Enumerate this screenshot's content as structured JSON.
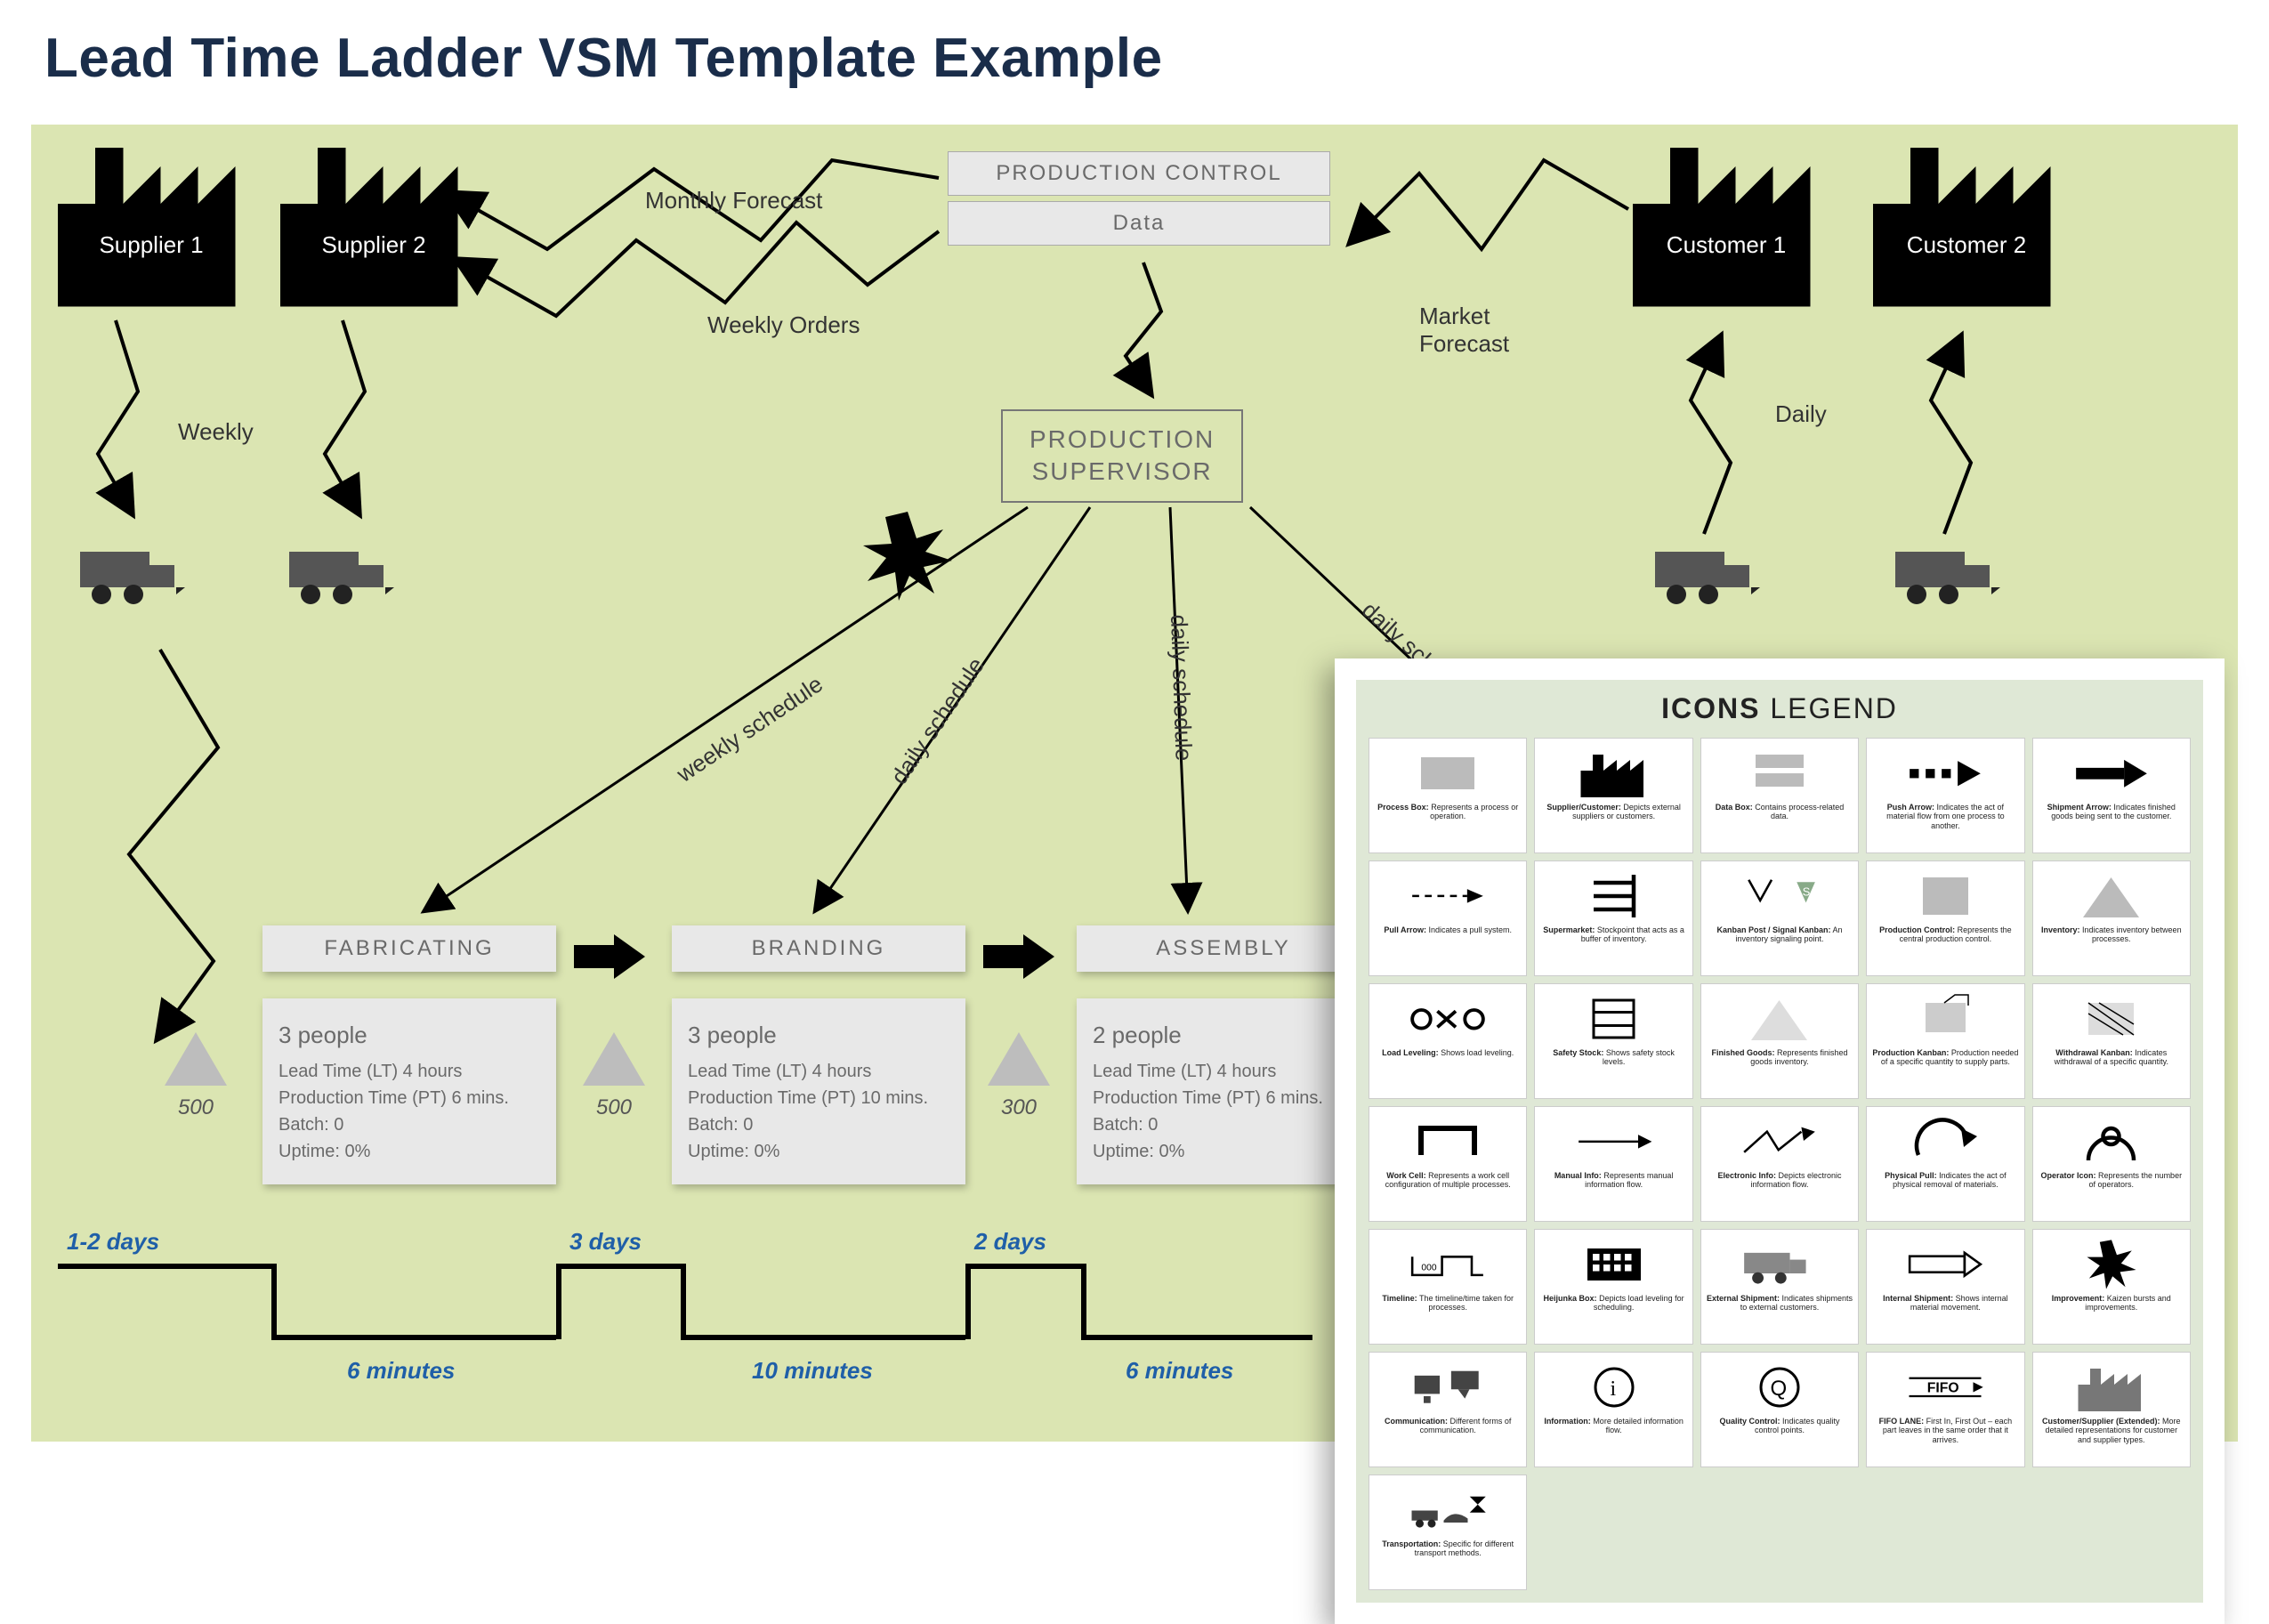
{
  "title": "Lead Time Ladder VSM Template Example",
  "suppliers": [
    "Supplier 1",
    "Supplier 2"
  ],
  "customers": [
    "Customer 1",
    "Customer 2"
  ],
  "production_control": {
    "top": "PRODUCTION CONTROL",
    "bottom": "Data"
  },
  "supervisor": "PRODUCTION\nSUPERVISOR",
  "flows": {
    "monthly_forecast": "Monthly Forecast",
    "weekly_orders": "Weekly Orders",
    "market_forecast": "Market\nForecast",
    "weekly": "Weekly",
    "daily": "Daily",
    "weekly_schedule": "weekly schedule",
    "daily_schedule": "daily schedule",
    "daily_schedule_2": "daily schedule",
    "daily_schedule_3": "daily schedule"
  },
  "processes": [
    {
      "name": "FABRICATING",
      "people": "3 people",
      "lines": [
        "Lead Time (LT) 4 hours",
        "Production Time (PT) 6 mins.",
        "Batch: 0",
        "Uptime: 0%"
      ],
      "inventory": "500",
      "lt_top": "1-2 days",
      "pt_bottom": "6 minutes"
    },
    {
      "name": "BRANDING",
      "people": "3 people",
      "lines": [
        "Lead Time (LT) 4 hours",
        "Production Time (PT) 10 mins.",
        "Batch: 0",
        "Uptime: 0%"
      ],
      "inventory": "500",
      "lt_top": "3 days",
      "pt_bottom": "10 minutes"
    },
    {
      "name": "ASSEMBLY",
      "people": "2 people",
      "lines": [
        "Lead Time (LT) 4 hours",
        "Production Time (PT) 6 mins.",
        "Batch: 0",
        "Uptime: 0%"
      ],
      "inventory": "300",
      "lt_top": "2 days",
      "pt_bottom": "6 minutes"
    }
  ],
  "legend": {
    "title_bold": "ICONS",
    "title_rest": " LEGEND",
    "items": [
      {
        "name": "Process Box",
        "desc": "Represents a process or operation."
      },
      {
        "name": "Supplier/Customer",
        "desc": "Depicts external suppliers or customers."
      },
      {
        "name": "Data Box",
        "desc": "Contains process-related data."
      },
      {
        "name": "Push Arrow",
        "desc": "Indicates the act of material flow from one process to another."
      },
      {
        "name": "Shipment Arrow",
        "desc": "Indicates finished goods being sent to the customer."
      },
      {
        "name": "Pull Arrow",
        "desc": "Indicates a pull system."
      },
      {
        "name": "Supermarket",
        "desc": "Stockpoint that acts as a buffer of inventory."
      },
      {
        "name": "Kanban Post / Signal Kanban",
        "desc": "An inventory signaling point."
      },
      {
        "name": "Production Control",
        "desc": "Represents the central production control."
      },
      {
        "name": "Inventory",
        "desc": "Indicates inventory between processes."
      },
      {
        "name": "Load Leveling",
        "desc": "Shows load leveling."
      },
      {
        "name": "Safety Stock",
        "desc": "Shows safety stock levels."
      },
      {
        "name": "Finished Goods",
        "desc": "Represents finished goods inventory."
      },
      {
        "name": "Production Kanban",
        "desc": "Production needed of a specific quantity to supply parts."
      },
      {
        "name": "Withdrawal Kanban",
        "desc": "Indicates withdrawal of a specific quantity."
      },
      {
        "name": "Work Cell",
        "desc": "Represents a work cell configuration of multiple processes."
      },
      {
        "name": "Manual Info",
        "desc": "Represents manual information flow."
      },
      {
        "name": "Electronic Info",
        "desc": "Depicts electronic information flow."
      },
      {
        "name": "Physical Pull",
        "desc": "Indicates the act of physical removal of materials."
      },
      {
        "name": "Operator Icon",
        "desc": "Represents the number of operators."
      },
      {
        "name": "Timeline",
        "desc": "The timeline/time taken for processes."
      },
      {
        "name": "Heijunka Box",
        "desc": "Depicts load leveling for scheduling."
      },
      {
        "name": "External Shipment",
        "desc": "Indicates shipments to external customers."
      },
      {
        "name": "Internal Shipment",
        "desc": "Shows internal material movement."
      },
      {
        "name": "Improvement",
        "desc": "Kaizen bursts and improvements."
      },
      {
        "name": "Communication",
        "desc": "Different forms of communication."
      },
      {
        "name": "Information",
        "desc": "More detailed information flow."
      },
      {
        "name": "Quality Control",
        "desc": "Indicates quality control points."
      },
      {
        "name": "FIFO LANE",
        "desc": "First In, First Out – each part leaves in the same order that it arrives."
      },
      {
        "name": "Customer/Supplier (Extended)",
        "desc": "More detailed representations for customer and supplier types."
      },
      {
        "name": "Transportation",
        "desc": "Specific for different transport methods."
      }
    ]
  }
}
